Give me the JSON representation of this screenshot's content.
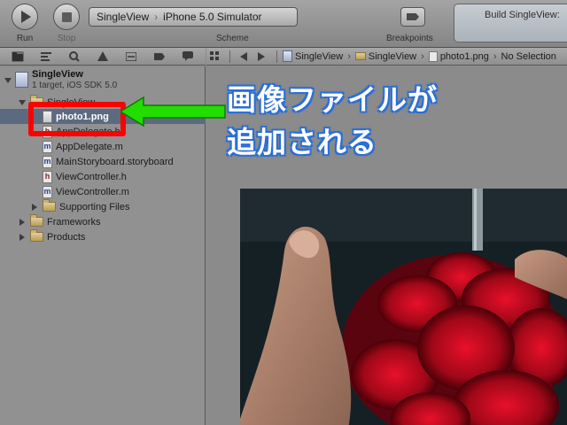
{
  "toolbar": {
    "run_label": "Run",
    "stop_label": "Stop",
    "scheme": {
      "target": "SingleView",
      "destination": "iPhone 5.0 Simulator",
      "caption": "Scheme"
    },
    "breakpoints_label": "Breakpoints",
    "activity_text": "Build SingleView:"
  },
  "navigator": {
    "project": {
      "name": "SingleView",
      "subtitle": "1 target, iOS SDK 5.0"
    },
    "group_label": "SingleView",
    "selected_file": "photo1.png",
    "files": [
      {
        "name": "AppDelegate.h",
        "type": "h"
      },
      {
        "name": "AppDelegate.m",
        "type": "m"
      },
      {
        "name": "MainStoryboard.storyboard",
        "type": "m"
      },
      {
        "name": "ViewController.h",
        "type": "h"
      },
      {
        "name": "ViewController.m",
        "type": "m"
      }
    ],
    "supporting_files": "Supporting Files",
    "frameworks": "Frameworks",
    "products": "Products"
  },
  "jump_bar": {
    "crumbs": [
      "SingleView",
      "SingleView",
      "photo1.png",
      "No Selection"
    ]
  },
  "annotation": {
    "line1": "画像ファイルが",
    "line2": "追加される",
    "arrow_color": "#22dd00",
    "box_color": "#ff0000",
    "text_outline_color": "#2a6fd6"
  }
}
